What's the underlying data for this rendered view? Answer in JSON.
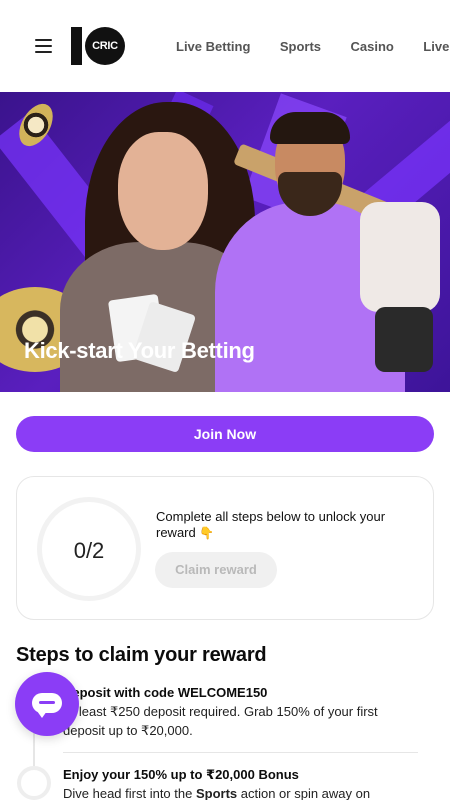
{
  "header": {
    "logo_text": "CRIC",
    "nav": [
      "Live Betting",
      "Sports",
      "Casino",
      "Live Casino"
    ]
  },
  "hero": {
    "title": "Kick-start Your Betting"
  },
  "join": {
    "label": "Join Now"
  },
  "progress": {
    "value": "0/2",
    "completed": 0,
    "total": 2,
    "message": "Complete all steps below to unlock your reward",
    "emoji": "👇",
    "claim_label": "Claim reward"
  },
  "steps": {
    "title": "Steps to claim your reward",
    "items": [
      {
        "title": "Deposit with code WELCOME150",
        "desc": "At least ₹250 deposit required. Grab 150% of your first deposit up to ₹20,000."
      },
      {
        "title": "Enjoy your 150% up to ₹20,000 Bonus",
        "desc_before": "Dive head first into the ",
        "desc_bold": "Sports",
        "desc_after": " action or spin away on"
      }
    ]
  },
  "colors": {
    "accent": "#8b3df6",
    "hero_bg": "#4a1aa8"
  },
  "icons": {
    "menu": "hamburger-icon",
    "chat": "chat-bubble-icon"
  }
}
